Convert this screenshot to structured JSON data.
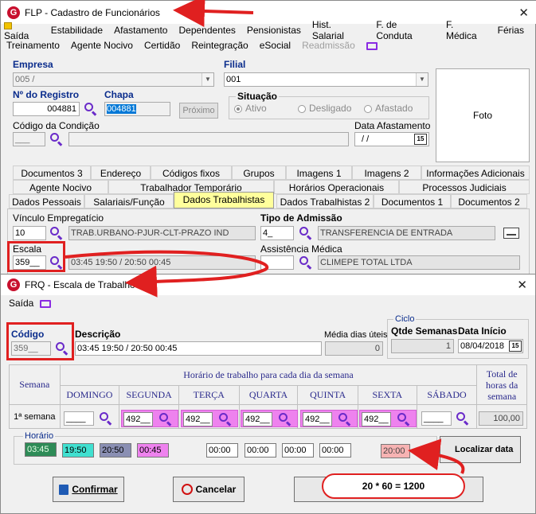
{
  "main_window": {
    "title": "FLP - Cadastro de Funcionários",
    "menu_row1": [
      "Saída",
      "Estabilidade",
      "Afastamento",
      "Dependentes",
      "Pensionistas",
      "Hist. Salarial",
      "F. de Conduta",
      "F. Médica",
      "Férias"
    ],
    "menu_row2": [
      "Treinamento",
      "Agente Nocivo",
      "Certidão",
      "Reintegração",
      "eSocial"
    ],
    "menu_row2_disabled": "Readmissão",
    "empresa_label": "Empresa",
    "empresa_value": "005 /",
    "filial_label": "Filial",
    "filial_value": "001",
    "registro_label": "Nº do Registro",
    "registro_value": "004881",
    "chapa_label": "Chapa",
    "chapa_value": "004881",
    "proximo_label": "Próximo",
    "situacao_label": "Situação",
    "situacao_options": [
      "Ativo",
      "Desligado",
      "Afastado"
    ],
    "codigo_condicao_label": "Código da Condição",
    "codigo_condicao_value": "___",
    "data_afastamento_label": "Data Afastamento",
    "data_afastamento_value": "/ /",
    "calendar_text": "15",
    "foto_label": "Foto",
    "tabs_row1": [
      "Documentos 3",
      "Endereço",
      "Códigos fixos",
      "Grupos",
      "Imagens 1",
      "Imagens 2",
      "Informações Adicionais"
    ],
    "tabs_row2": [
      "Agente Nocivo",
      "Trabalhador Temporário",
      "Horários Operacionais",
      "Processos Judiciais"
    ],
    "tabs_row3": [
      "Dados Pessoais",
      "Salariais/Função",
      "Dados Trabalhistas",
      "Dados Trabalhistas 2",
      "Documentos 1",
      "Documentos 2"
    ],
    "vinculo_label": "Vínculo Empregatício",
    "vinculo_code": "10",
    "vinculo_desc": "TRAB.URBANO-PJUR-CLT-PRAZO IND",
    "tipo_admissao_label": "Tipo de Admissão",
    "tipo_admissao_code": "4_",
    "tipo_admissao_desc": "TRANSFERENCIA DE ENTRADA",
    "escala_label": "Escala",
    "escala_code": "359__",
    "escala_desc": "03:45 19:50 / 20:50 00:45",
    "assistencia_label": "Assistência Médica",
    "assistencia_desc": "CLIMEPE TOTAL LTDA"
  },
  "sub_window": {
    "title": "FRQ - Escala de Trabalho",
    "menu": "Saída",
    "codigo_label": "Código",
    "codigo_value": "359__",
    "descricao_label": "Descrição",
    "descricao_value": "03:45 19:50 / 20:50 00:45",
    "media_label": "Média dias úteis",
    "media_value": "0",
    "ciclo_label": "Ciclo",
    "qtde_label": "Qtde Semanas",
    "qtde_value": "1",
    "data_inicio_label": "Data Início",
    "data_inicio_value": "08/04/2018",
    "horario_header": "Horário de trabalho para cada dia da semana",
    "semana_label": "Semana",
    "total_label": "Total de horas da semana",
    "days": [
      "DOMINGO",
      "SEGUNDA",
      "TERÇA",
      "QUARTA",
      "QUINTA",
      "SEXTA",
      "SÁBADO"
    ],
    "row_label": "1ª semana",
    "day_values": [
      "____",
      "492__",
      "492__",
      "492__",
      "492__",
      "492__",
      "____"
    ],
    "total_value": "100,00",
    "horario_group_label": "Horário",
    "horarios": [
      "03:45",
      "19:50",
      "20:50",
      "00:45",
      "00:00",
      "00:00",
      "00:00",
      "00:00",
      "20:00"
    ],
    "localizar_label": "Localizar data",
    "confirmar_label": "Confirmar",
    "cancelar_label": "Cancelar",
    "callout_text": "20 * 60 = 1200"
  },
  "colors": {
    "pink": "#ee82ee",
    "annotation_red": "#e02020",
    "label_blue": "#0a2c8c"
  }
}
